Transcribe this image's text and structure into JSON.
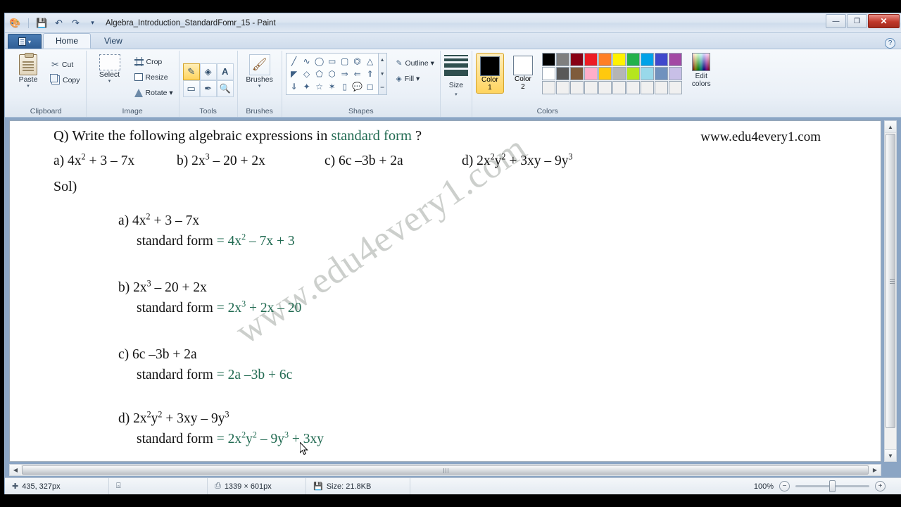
{
  "window": {
    "title": "Algebra_Introduction_StandardFomr_15 - Paint",
    "quick_access": [
      "paint-icon",
      "save-icon",
      "undo-icon",
      "redo-icon",
      "customize-icon"
    ],
    "controls": {
      "minimize": "—",
      "restore": "❐",
      "close": "✕"
    }
  },
  "tabs": {
    "file_label": "",
    "items": [
      "Home",
      "View"
    ],
    "active": "Home",
    "help": "?"
  },
  "ribbon": {
    "groups": [
      {
        "label": "Clipboard",
        "big": {
          "label": "Paste",
          "caret": "▾"
        },
        "small": [
          {
            "label": "Cut"
          },
          {
            "label": "Copy"
          }
        ]
      },
      {
        "label": "Image",
        "big": {
          "label": "Select",
          "caret": "▾"
        },
        "small": [
          {
            "label": "Crop"
          },
          {
            "label": "Resize"
          },
          {
            "label": "Rotate ▾"
          }
        ]
      },
      {
        "label": "Tools",
        "tools": [
          "pencil-icon",
          "fill-icon",
          "text-icon",
          "eraser-icon",
          "color-picker-icon",
          "magnifier-icon"
        ],
        "selected_tool": "pencil-icon"
      },
      {
        "label": "Brushes",
        "big": {
          "label": "Brushes",
          "caret": "▾"
        }
      },
      {
        "label": "Shapes",
        "shapes": [
          "line",
          "curve",
          "oval",
          "rectangle",
          "rounded-rectangle",
          "polygon",
          "triangle",
          "right-triangle",
          "diamond",
          "pentagon",
          "hexagon",
          "right-arrow",
          "left-arrow",
          "up-arrow",
          "down-arrow",
          "four-point-star",
          "five-point-star",
          "six-point-star",
          "rect-callout",
          "rounded-callout",
          "cloud-callout"
        ],
        "outline_label": "Outline ▾",
        "fill_label": "Fill ▾"
      },
      {
        "label": "Size",
        "caret": "▾"
      },
      {
        "label": "Colors",
        "color1_label": "Color\n1",
        "color1_line1": "Color",
        "color1_line2": "1",
        "color2_line1": "Color",
        "color2_line2": "2",
        "color1_value": "#000000",
        "color2_value": "#ffffff",
        "palette_row1": [
          "#000000",
          "#7f7f7f",
          "#880015",
          "#ed1c24",
          "#ff7f27",
          "#fff200",
          "#22b14c",
          "#00a2e8",
          "#3f48cc",
          "#a349a4"
        ],
        "palette_row2": [
          "#ffffff",
          "#595959",
          "#7f5b3b",
          "#ffaec9",
          "#ffc90e",
          "#b5b5b5",
          "#b5e61d",
          "#99d9ea",
          "#7092be",
          "#c8bfe7"
        ],
        "palette_row3": [
          "#f0f0f0",
          "#f0f0f0",
          "#f0f0f0",
          "#f0f0f0",
          "#f0f0f0",
          "#f0f0f0",
          "#f0f0f0",
          "#f0f0f0",
          "#f0f0f0",
          "#f0f0f0"
        ],
        "edit_colors_line1": "Edit",
        "edit_colors_line2": "colors"
      }
    ]
  },
  "document": {
    "question": {
      "prefix": "Q) Write the following algebraic expressions in ",
      "highlight": "standard form",
      "suffix": " ?"
    },
    "website": "www.edu4every1.com",
    "watermark": "www.edu4every1.com",
    "problems": [
      {
        "label": "a)",
        "expr_html": "4x<sup>2</sup> + 3 – 7x"
      },
      {
        "label": "b)",
        "expr_html": "2x<sup>3</sup> – 20 + 2x"
      },
      {
        "label": "c)",
        "expr_html": "6c –3b + 2a"
      },
      {
        "label": "d)",
        "expr_html": "2x<sup>2</sup>y<sup>2</sup> + 3xy – 9y<sup>3</sup>"
      }
    ],
    "sol_label": "Sol)",
    "std_form_label": "standard form",
    "solutions": [
      {
        "label": "a)",
        "expr_html": "4x<sup>2</sup> + 3 – 7x",
        "answer_html": "= 4x<sup>2</sup> – 7x + 3"
      },
      {
        "label": "b)",
        "expr_html": "2x<sup>3</sup> – 20 + 2x",
        "answer_html": "= 2x<sup>3</sup> + 2x – 20"
      },
      {
        "label": "c)",
        "expr_html": "6c –3b + 2a",
        "answer_html": "= 2a –3b + 6c"
      },
      {
        "label": "d)",
        "expr_html": "2x<sup>2</sup>y<sup>2</sup> + 3xy – 9y<sup>3</sup>",
        "answer_html": "= 2x<sup>2</sup>y<sup>2</sup> – 9y<sup>3</sup> + 3xy"
      }
    ],
    "accent_green": "#226b52"
  },
  "statusbar": {
    "cursor_position": "435, 327px",
    "selection_size": "",
    "image_size": "1339 × 601px",
    "file_size": "Size: 21.8KB",
    "zoom_percent": "100%",
    "zoom_out": "−",
    "zoom_in": "+"
  }
}
